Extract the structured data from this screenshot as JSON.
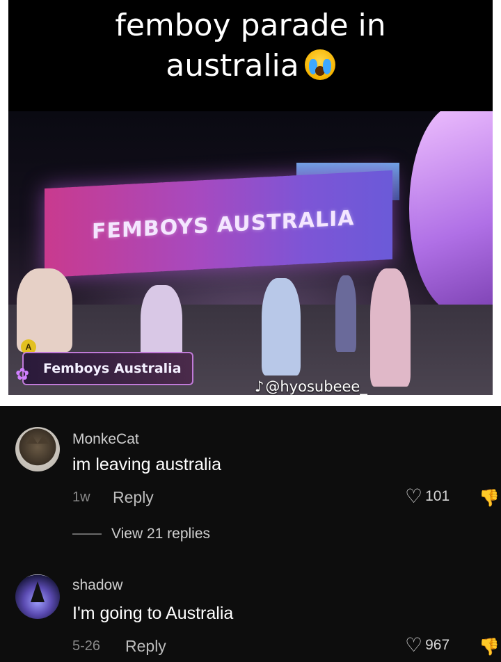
{
  "meme": {
    "caption_line1": "femboy parade in",
    "caption_line2": "australia",
    "banner_text": "FEMBOYS AUSTRALIA",
    "lower_third": "Femboys Australia",
    "badge": "A",
    "tiktok_handle": "@hyosubeee_"
  },
  "comments": [
    {
      "username": "MonkeCat",
      "text": "im leaving australia",
      "time": "1w",
      "reply_label": "Reply",
      "likes": "101",
      "view_replies": "View 21 replies"
    },
    {
      "username": "shadow",
      "text": "I'm going to Australia",
      "time": "5-26",
      "reply_label": "Reply",
      "likes": "967"
    }
  ],
  "icons": {
    "like": "heart-outline-icon",
    "dislike": "thumbs-down-icon",
    "tiktok": "tiktok-note-icon",
    "emoji": "crying-face-emoji-icon"
  }
}
